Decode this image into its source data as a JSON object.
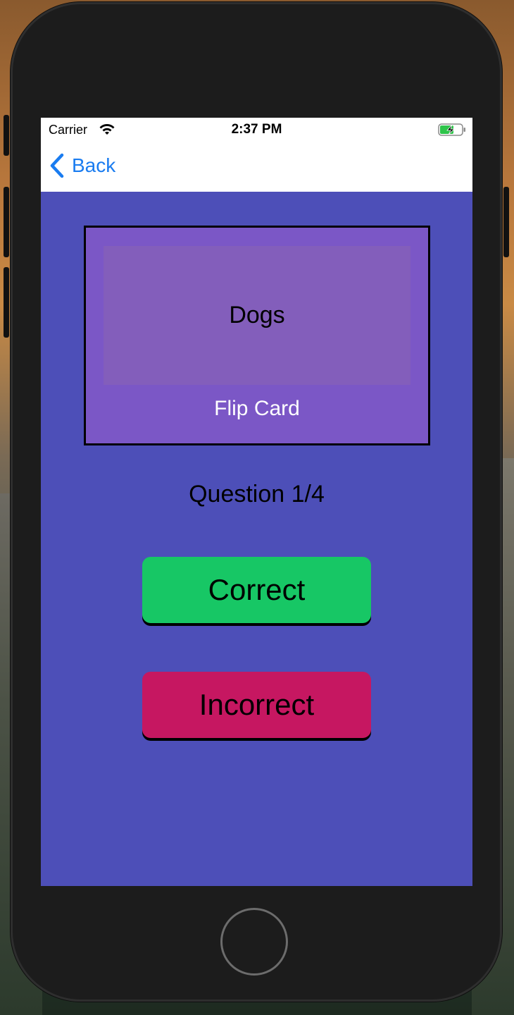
{
  "status_bar": {
    "carrier": "Carrier",
    "time": "2:37 PM",
    "wifi_icon": "wifi-icon",
    "battery_icon": "battery-charging-icon"
  },
  "nav": {
    "back_label": "Back",
    "back_icon": "chevron-left-icon",
    "accent_color": "#1a7cf0"
  },
  "card": {
    "front_text": "Dogs",
    "flip_label": "Flip Card",
    "color": "#7b57c6"
  },
  "progress": {
    "label": "Question 1/4"
  },
  "answers": {
    "correct_label": "Correct",
    "incorrect_label": "Incorrect",
    "correct_color": "#17c765",
    "incorrect_color": "#c61761"
  },
  "colors": {
    "screen_background": "#4d4fb8"
  }
}
